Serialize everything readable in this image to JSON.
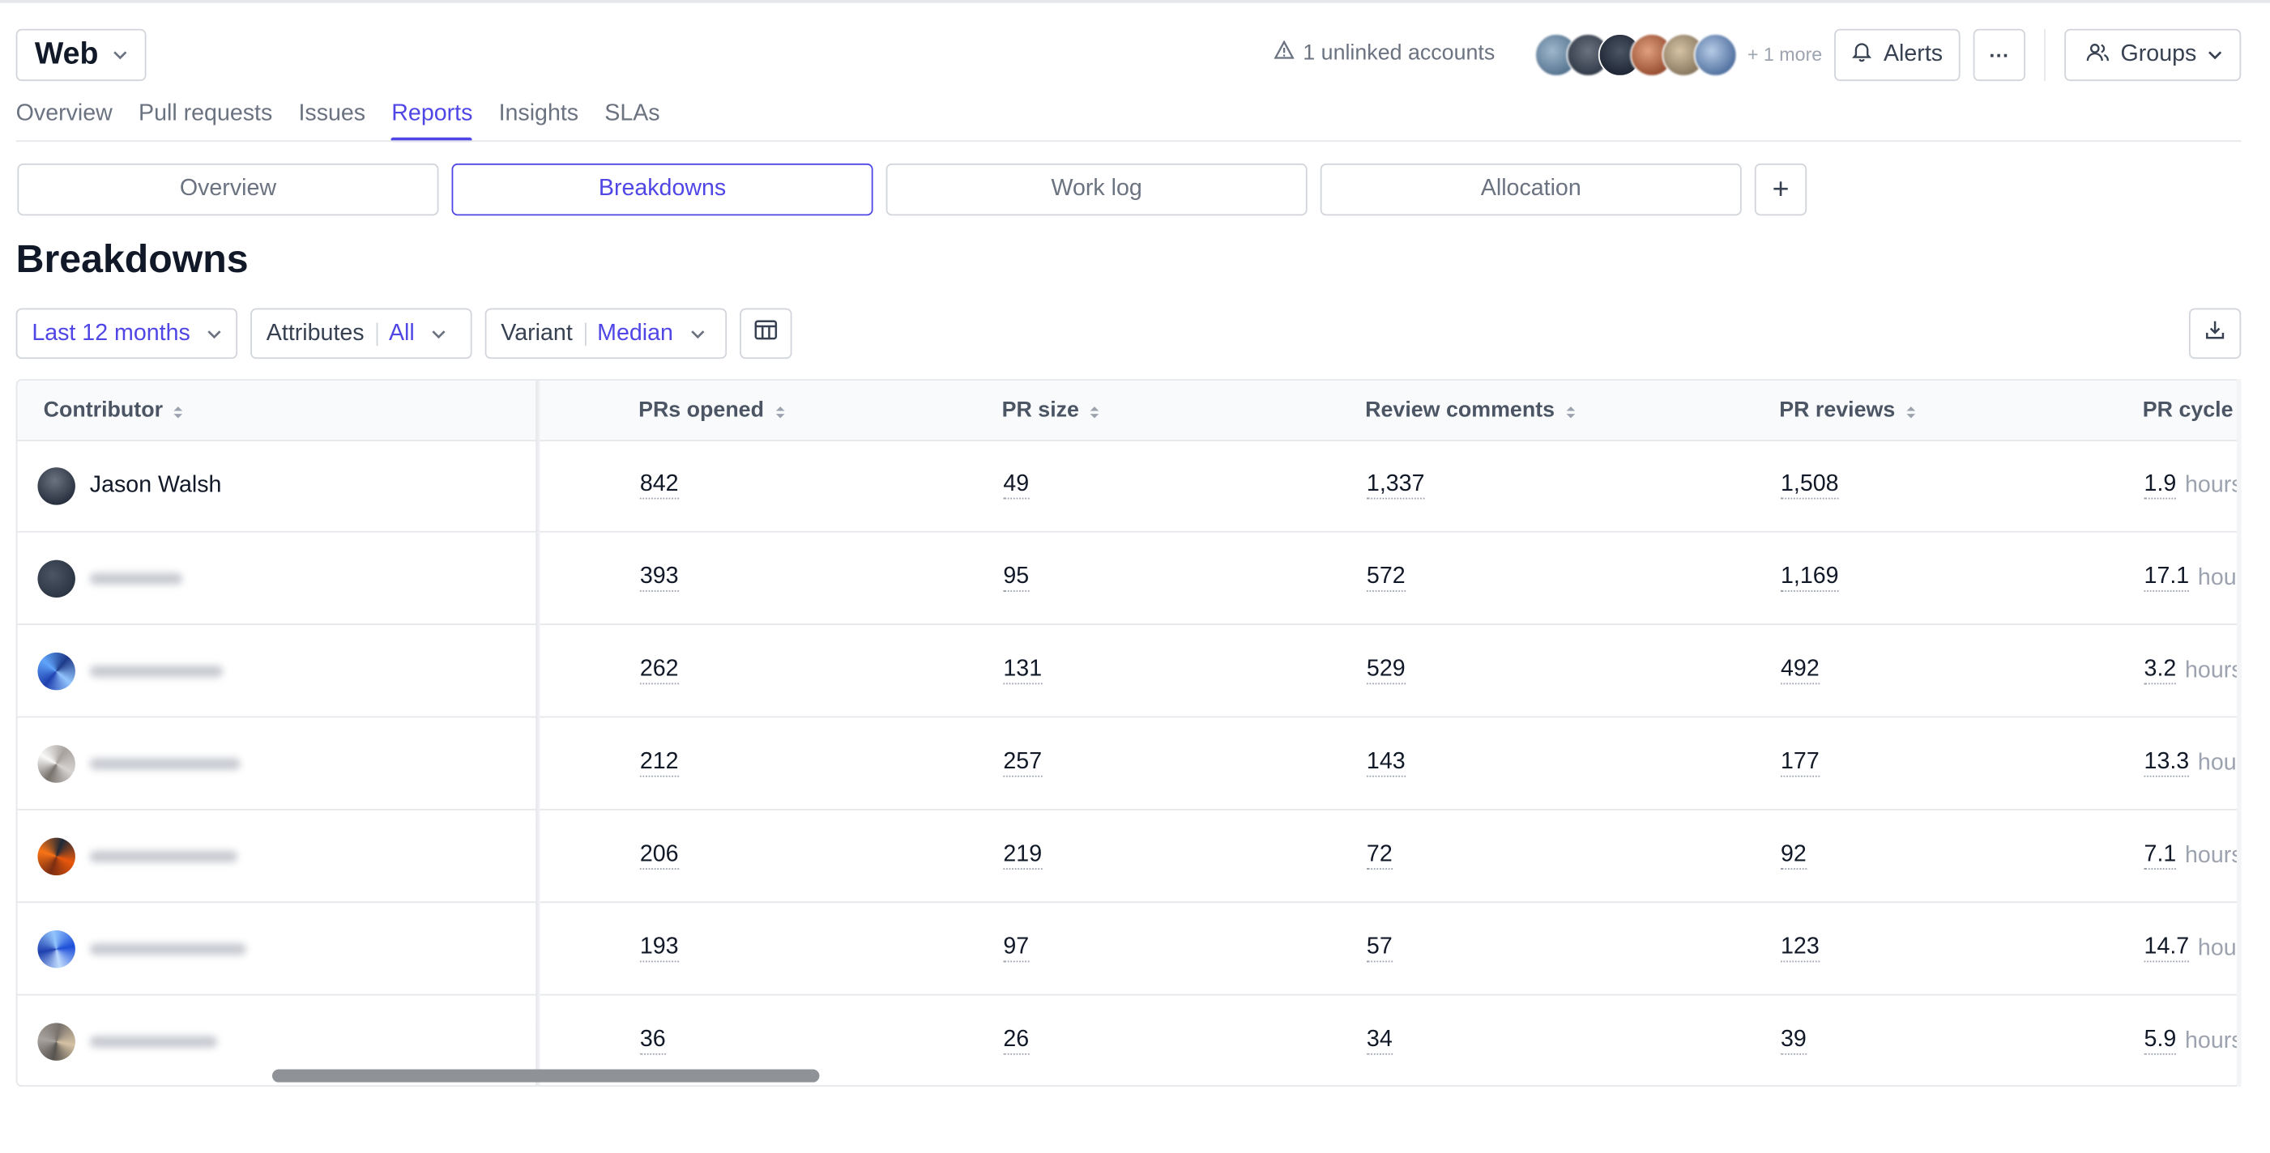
{
  "header": {
    "project_title": "Web",
    "unlinked_text": "1 unlinked accounts",
    "more_text": "+ 1 more",
    "alerts_label": "Alerts",
    "more_menu_label": "···",
    "groups_label": "Groups"
  },
  "nav": {
    "tabs": [
      {
        "label": "Overview",
        "active": false
      },
      {
        "label": "Pull requests",
        "active": false
      },
      {
        "label": "Issues",
        "active": false
      },
      {
        "label": "Reports",
        "active": true
      },
      {
        "label": "Insights",
        "active": false
      },
      {
        "label": "SLAs",
        "active": false
      }
    ]
  },
  "subtabs": {
    "items": [
      {
        "label": "Overview",
        "active": false
      },
      {
        "label": "Breakdowns",
        "active": true
      },
      {
        "label": "Work log",
        "active": false
      },
      {
        "label": "Allocation",
        "active": false
      }
    ],
    "add_label": "+"
  },
  "page": {
    "title": "Breakdowns"
  },
  "filters": {
    "range_label": "Last 12 months",
    "attributes_label": "Attributes",
    "attributes_value": "All",
    "variant_label": "Variant",
    "variant_value": "Median"
  },
  "table": {
    "columns": [
      "Contributor",
      "PRs opened",
      "PR size",
      "Review comments",
      "PR reviews",
      "PR cycle t"
    ],
    "rows": [
      {
        "name": "Jason Walsh",
        "prs_opened": "842",
        "pr_size": "49",
        "review_comments": "1,337",
        "pr_reviews": "1,508",
        "cycle_value": "1.9",
        "cycle_unit": "hours"
      },
      {
        "name": "",
        "prs_opened": "393",
        "pr_size": "95",
        "review_comments": "572",
        "pr_reviews": "1,169",
        "cycle_value": "17.1",
        "cycle_unit": "hours"
      },
      {
        "name": "",
        "prs_opened": "262",
        "pr_size": "131",
        "review_comments": "529",
        "pr_reviews": "492",
        "cycle_value": "3.2",
        "cycle_unit": "hours"
      },
      {
        "name": "",
        "prs_opened": "212",
        "pr_size": "257",
        "review_comments": "143",
        "pr_reviews": "177",
        "cycle_value": "13.3",
        "cycle_unit": "hours"
      },
      {
        "name": "",
        "prs_opened": "206",
        "pr_size": "219",
        "review_comments": "72",
        "pr_reviews": "92",
        "cycle_value": "7.1",
        "cycle_unit": "hours"
      },
      {
        "name": "",
        "prs_opened": "193",
        "pr_size": "97",
        "review_comments": "57",
        "pr_reviews": "123",
        "cycle_value": "14.7",
        "cycle_unit": "hours"
      },
      {
        "name": "",
        "prs_opened": "36",
        "pr_size": "26",
        "review_comments": "34",
        "pr_reviews": "39",
        "cycle_value": "5.9",
        "cycle_unit": "hours"
      }
    ]
  },
  "colors": {
    "accent": "#4f46e5",
    "border": "#d1d5db",
    "muted_text": "#6b7280"
  },
  "icons": [
    "chevron-down-icon",
    "warning-icon",
    "bell-icon",
    "users-icon",
    "columns-icon",
    "download-icon",
    "sort-icon"
  ]
}
